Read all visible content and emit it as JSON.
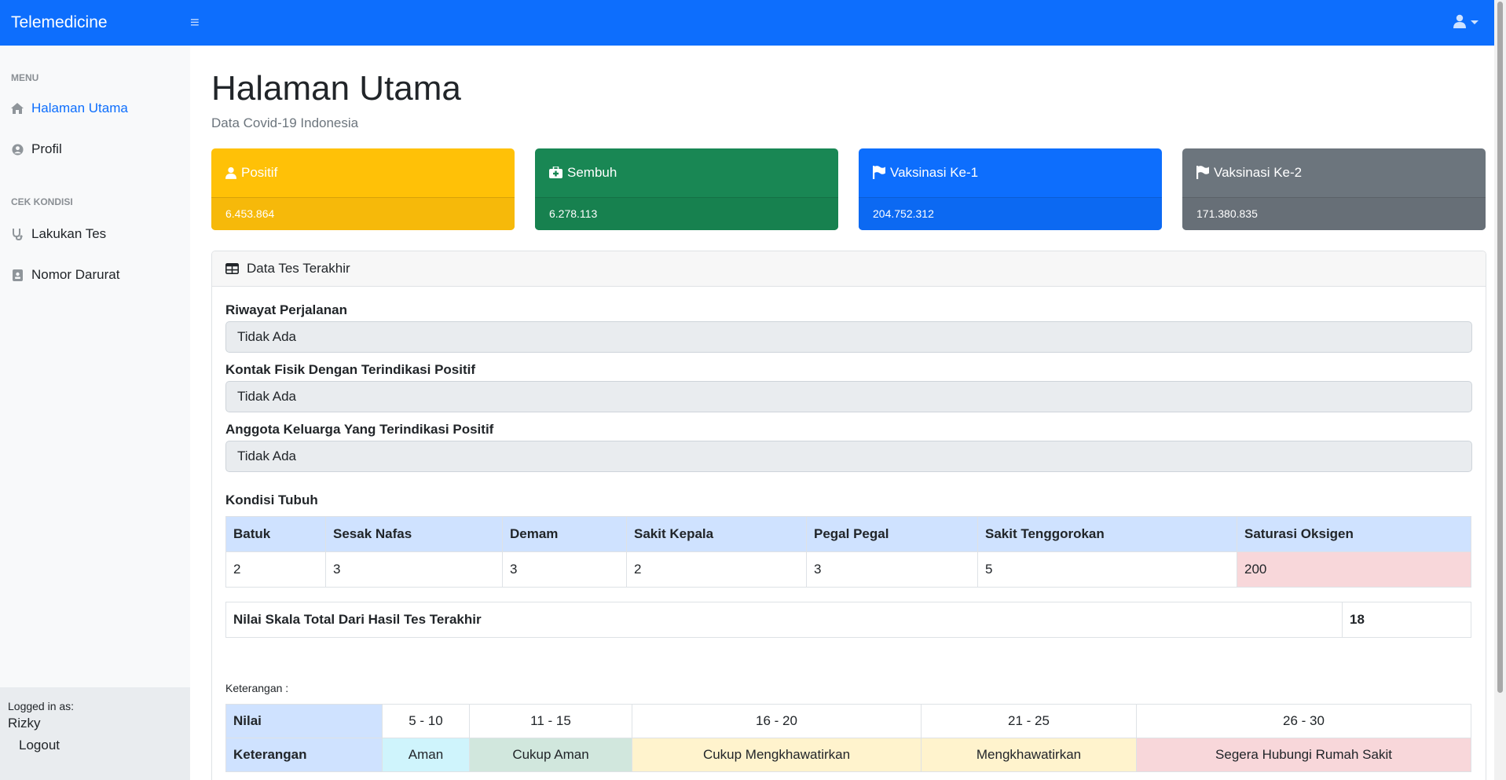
{
  "navbar": {
    "brand": "Telemedicine",
    "menu_icon": "hamburger-icon",
    "user_icon": "user-icon"
  },
  "sidebar": {
    "sections": [
      {
        "heading": "Menu",
        "items": [
          {
            "label": "Halaman Utama",
            "icon": "home-icon",
            "active": true
          },
          {
            "label": "Profil",
            "icon": "user-circle-icon"
          }
        ]
      },
      {
        "heading": "Cek Kondisi",
        "items": [
          {
            "label": "Lakukan Tes",
            "icon": "stethoscope-icon"
          },
          {
            "label": "Nomor Darurat",
            "icon": "address-book-icon"
          }
        ]
      }
    ],
    "footer": {
      "logged_label": "Logged in as:",
      "user": "Rizky",
      "logout": "Logout"
    }
  },
  "page": {
    "title": "Halaman Utama",
    "subtitle": "Data Covid-19 Indonesia"
  },
  "cards": [
    {
      "label": "Positif",
      "value": "6.453.864",
      "icon": "user-icon",
      "color": "#ffc107"
    },
    {
      "label": "Sembuh",
      "value": "6.278.113",
      "icon": "medkit-icon",
      "color": "#198754"
    },
    {
      "label": "Vaksinasi Ke-1",
      "value": "204.752.312",
      "icon": "flag-icon",
      "color": "#0d6efd"
    },
    {
      "label": "Vaksinasi Ke-2",
      "value": "171.380.835",
      "icon": "flag-icon",
      "color": "#6c757d"
    }
  ],
  "panel": {
    "title": "Data Tes Terakhir",
    "icon": "table-icon",
    "fields": [
      {
        "label": "Riwayat Perjalanan",
        "value": "Tidak Ada"
      },
      {
        "label": "Kontak Fisik Dengan Terindikasi Positif",
        "value": "Tidak Ada"
      },
      {
        "label": "Anggota Keluarga Yang Terindikasi Positif",
        "value": "Tidak Ada"
      }
    ],
    "kondisi_label": "Kondisi Tubuh",
    "kondisi_headers": [
      "Batuk",
      "Sesak Nafas",
      "Demam",
      "Sakit Kepala",
      "Pegal Pegal",
      "Sakit Tenggorokan",
      "Saturasi Oksigen"
    ],
    "kondisi_values": [
      "2",
      "3",
      "3",
      "2",
      "3",
      "5",
      "200"
    ],
    "total_label": "Nilai Skala Total Dari Hasil Tes Terakhir",
    "total_value": "18",
    "keterangan_label": "Keterangan :",
    "legend": {
      "nilai_head": "Nilai",
      "ket_head": "Keterangan",
      "ranges": [
        "5 - 10",
        "11 - 15",
        "16 - 20",
        "21 - 25",
        "26 - 30"
      ],
      "descriptions": [
        "Aman",
        "Cukup Aman",
        "Cukup Mengkhawatirkan",
        "Mengkhawatirkan",
        "Segera Hubungi Rumah Sakit"
      ]
    }
  }
}
